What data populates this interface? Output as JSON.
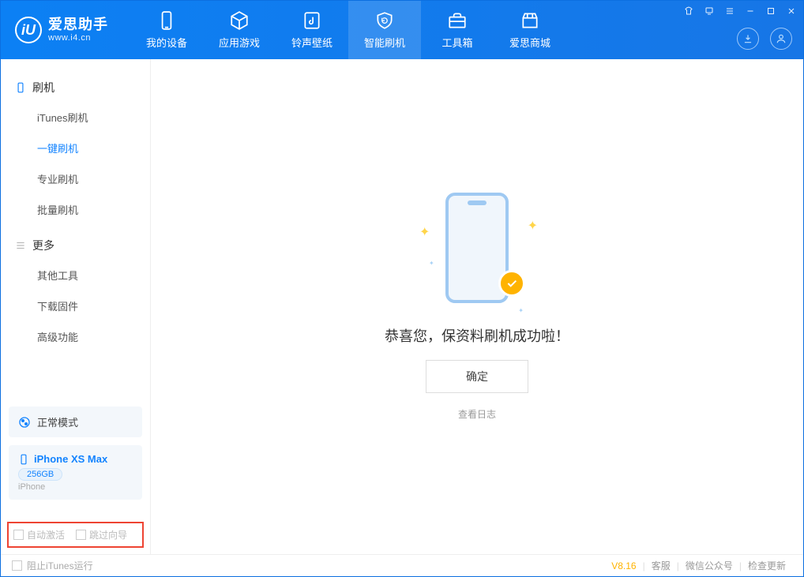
{
  "app": {
    "title": "爱思助手",
    "subtitle": "www.i4.cn",
    "logo_mark": "iU"
  },
  "tabs": {
    "device": "我的设备",
    "apps": "应用游戏",
    "ringtones": "铃声壁纸",
    "flash": "智能刷机",
    "toolbox": "工具箱",
    "store": "爱思商城"
  },
  "sidebar": {
    "group_flash": "刷机",
    "items_flash": {
      "itunes": "iTunes刷机",
      "onekey": "一键刷机",
      "pro": "专业刷机",
      "batch": "批量刷机"
    },
    "group_more": "更多",
    "items_more": {
      "other": "其他工具",
      "firmware": "下载固件",
      "advanced": "高级功能"
    }
  },
  "mode": {
    "label": "正常模式"
  },
  "device": {
    "name": "iPhone XS Max",
    "capacity": "256GB",
    "type": "iPhone"
  },
  "options": {
    "auto_activate": "自动激活",
    "skip_guide": "跳过向导"
  },
  "main": {
    "success_message": "恭喜您，保资料刷机成功啦！",
    "confirm": "确定",
    "view_log": "查看日志"
  },
  "footer": {
    "block_itunes": "阻止iTunes运行",
    "version": "V8.16",
    "support": "客服",
    "wechat": "微信公众号",
    "checkupdate": "检查更新"
  }
}
